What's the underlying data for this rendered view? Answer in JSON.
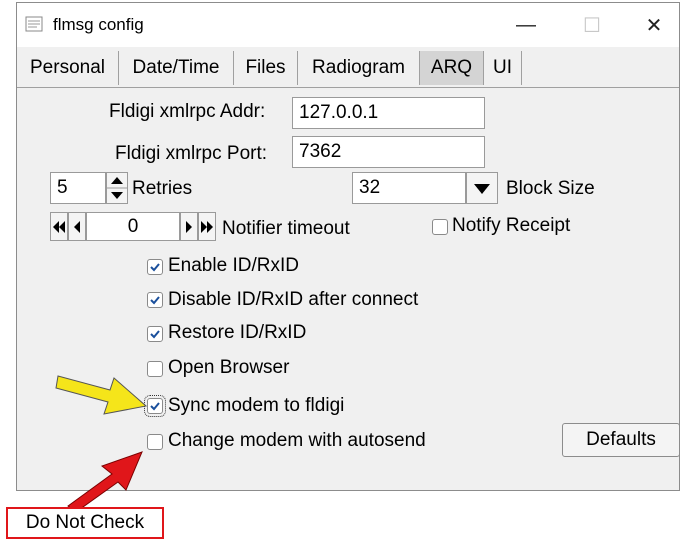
{
  "window": {
    "title": "flmsg config",
    "minimize": "—",
    "maximize": "☐",
    "close": "✕"
  },
  "tabs": [
    {
      "label": "Personal"
    },
    {
      "label": "Date/Time"
    },
    {
      "label": "Files"
    },
    {
      "label": "Radiogram"
    },
    {
      "label": "ARQ",
      "active": true
    },
    {
      "label": "UI"
    }
  ],
  "form": {
    "addr_label": "Fldigi xmlrpc Addr:",
    "addr_value": "127.0.0.1",
    "port_label": "Fldigi xmlrpc Port:",
    "port_value": "7362",
    "retries_value": "5",
    "retries_label": "Retries",
    "block_size_value": "32",
    "block_size_label": "Block Size",
    "notifier_value": "0",
    "notifier_label": "Notifier timeout",
    "notify_receipt_label": "Notify Receipt",
    "notify_receipt_checked": false
  },
  "checkboxes": [
    {
      "label": "Enable ID/RxID",
      "checked": true
    },
    {
      "label": "Disable ID/RxID after connect",
      "checked": true
    },
    {
      "label": "Restore ID/RxID",
      "checked": true
    },
    {
      "label": "Open Browser",
      "checked": false
    },
    {
      "label": "Sync modem to fldigi",
      "checked": true
    },
    {
      "label": "Change modem with autosend",
      "checked": false
    }
  ],
  "buttons": {
    "defaults": "Defaults"
  },
  "annotation": {
    "callout_text": "Do Not Check",
    "yellow_arrow_color": "#f5e51a",
    "red_arrow_color": "#e0161a"
  },
  "icons": {
    "spin": "spinner-icon",
    "dropdown": "dropdown-arrow-icon",
    "first": "double-left-icon",
    "prev": "left-icon",
    "next": "right-icon",
    "last": "double-right-icon"
  }
}
